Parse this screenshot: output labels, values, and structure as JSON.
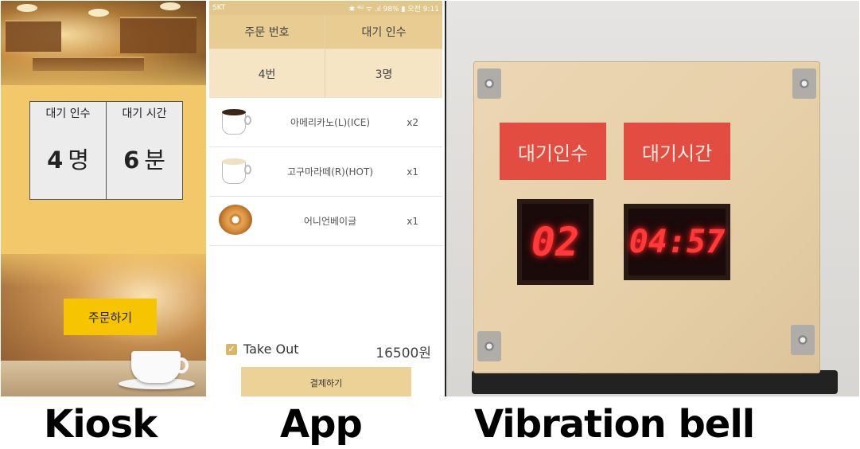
{
  "kiosk": {
    "wait_count_label": "대기 인수",
    "wait_time_label": "대기 시간",
    "wait_count_number": "4",
    "wait_count_unit": "명",
    "wait_time_number": "6",
    "wait_time_unit": "분",
    "order_button": "주문하기"
  },
  "app": {
    "status": {
      "carrier": "SKT",
      "right": "✱ ⁴ᴳ ᯤ .ıl 98% ▮ 오전 9:11"
    },
    "header": {
      "order_number_label": "주문 번호",
      "waiting_label": "대기 인수",
      "order_number_value": "4번",
      "waiting_value": "3명"
    },
    "items": [
      {
        "name": "아메리카노(L)(ICE)",
        "qty": "x2",
        "icon": "coffee-cup-icon"
      },
      {
        "name": "고구마라떼(R)(HOT)",
        "qty": "x1",
        "icon": "latte-cup-icon"
      },
      {
        "name": "어니언베이글",
        "qty": "x1",
        "icon": "bagel-icon"
      }
    ],
    "takeout": {
      "checked": true,
      "check_mark": "✓",
      "label": "Take Out"
    },
    "total": "16500원",
    "pay_button": "결제하기"
  },
  "bell": {
    "count_label": "대기인수",
    "time_label": "대기시간",
    "count_value": "02",
    "time_value": "04:57",
    "display_color": "#ff3a3a",
    "label_color": "#e34c40"
  },
  "captions": {
    "kiosk": "Kiosk",
    "app": "App",
    "bell": "Vibration bell"
  }
}
